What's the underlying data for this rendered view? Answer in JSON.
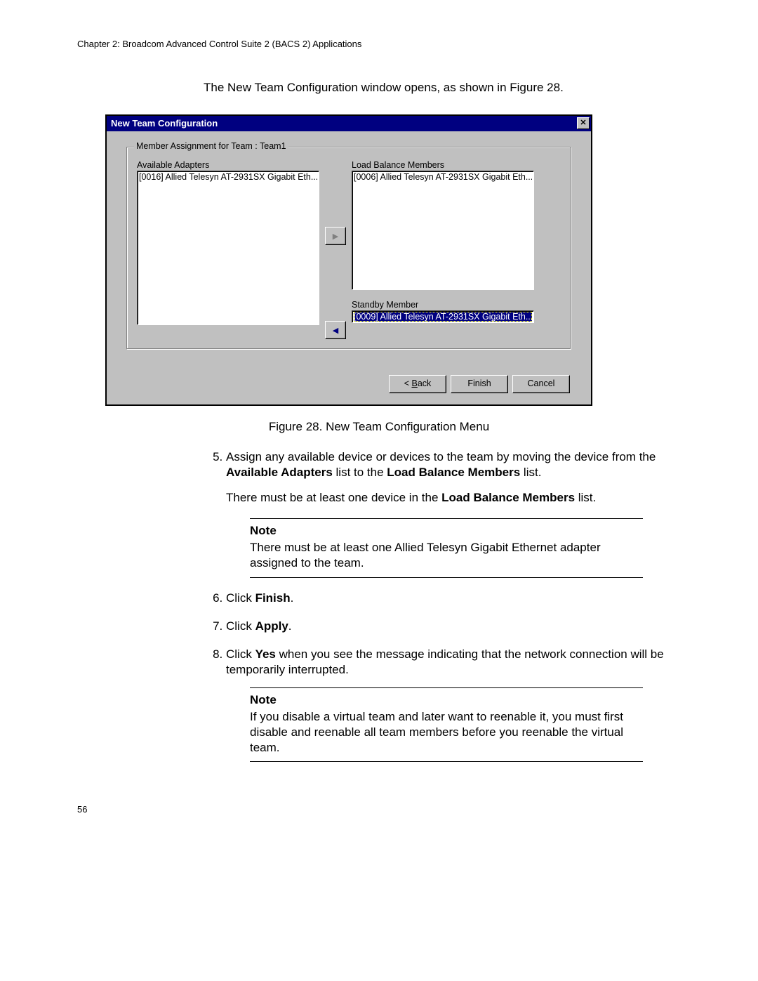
{
  "header": "Chapter 2: Broadcom Advanced Control Suite 2 (BACS 2) Applications",
  "intro": "The New Team Configuration window opens, as shown in Figure 28.",
  "dialog": {
    "title": "New Team Configuration",
    "close_glyph": "✕",
    "group_legend": "Member Assignment for Team : Team1",
    "available_label": "Available Adapters",
    "available_item": "[0016] Allied Telesyn AT-2931SX Gigabit Eth...",
    "load_label": "Load Balance Members",
    "load_item": "[0006] Allied Telesyn AT-2931SX Gigabit Eth...",
    "standby_label": "Standby Member",
    "standby_item": "[0009] Allied Telesyn AT-2931SX Gigabit Eth...",
    "arrow_right": "▶",
    "arrow_left": "◀",
    "back_pre": "< ",
    "back_u": "B",
    "back_post": "ack",
    "finish": "Finish",
    "cancel": "Cancel"
  },
  "figure_caption": "Figure 28. New Team Configuration Menu",
  "step5_a": "Assign any available device or devices to the team by moving the device from the ",
  "step5_b1": "Available Adapters",
  "step5_c": " list to the ",
  "step5_b2": "Load Balance Members",
  "step5_d": " list.",
  "step5_para_a": "There must be at least one device in the ",
  "step5_para_b": "Load Balance Members",
  "step5_para_c": " list.",
  "note1_title": "Note",
  "note1_body": "There must be at least one Allied Telesyn Gigabit Ethernet adapter assigned to the team.",
  "step6_a": "Click ",
  "step6_b": "Finish",
  "step6_c": ".",
  "step7_a": "Click ",
  "step7_b": "Apply",
  "step7_c": ".",
  "step8_a": "Click ",
  "step8_b": "Yes",
  "step8_c": " when you see the message indicating that the network connection will be temporarily interrupted.",
  "note2_title": "Note",
  "note2_body": "If you disable a virtual team and later want to reenable it, you must first disable and reenable all team members before you reenable the virtual team.",
  "page_number": "56"
}
